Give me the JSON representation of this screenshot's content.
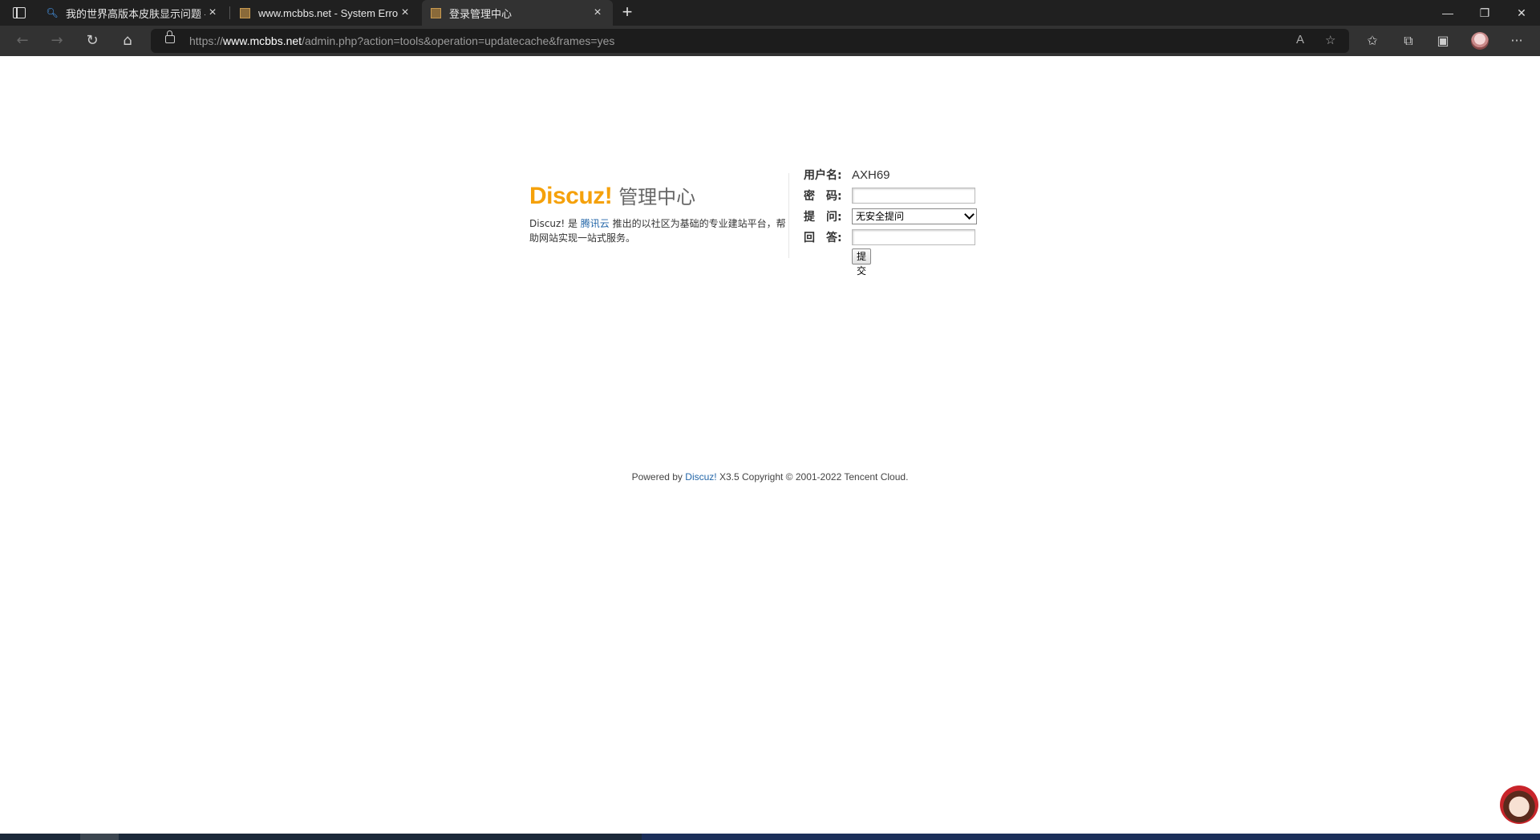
{
  "browser": {
    "tabs": [
      {
        "title": "我的世界高版本皮肤显示问题 - 搜索",
        "icon": "search-icon",
        "active": false
      },
      {
        "title": "www.mcbbs.net - System Error",
        "icon": "mcbbs-block-icon",
        "active": false
      },
      {
        "title": "登录管理中心",
        "icon": "mcbbs-block-icon",
        "active": true
      }
    ],
    "address": {
      "scheme": "https://",
      "host": "www.mcbbs.net",
      "path": "/admin.php?action=tools&operation=updatecache&frames=yes"
    }
  },
  "logo": {
    "brand": "Discuz!",
    "subtitle": "管理中心"
  },
  "description": {
    "prefix": "Discuz! 是",
    "link": "腾讯云",
    "suffix": "推出的以社区为基础的专业建站平台，帮助网站实现一站式服务。"
  },
  "login": {
    "username_label": "用户名:",
    "username_value": "AXH69",
    "password_label": "密　码:",
    "question_label": "提　问:",
    "question_selected": "无安全提问",
    "answer_label": "回　答:",
    "submit_label": "提交"
  },
  "footer": {
    "prefix": "Powered by",
    "link": "Discuz!",
    "suffix": "X3.5 Copyright © 2001-2022 Tencent Cloud."
  }
}
